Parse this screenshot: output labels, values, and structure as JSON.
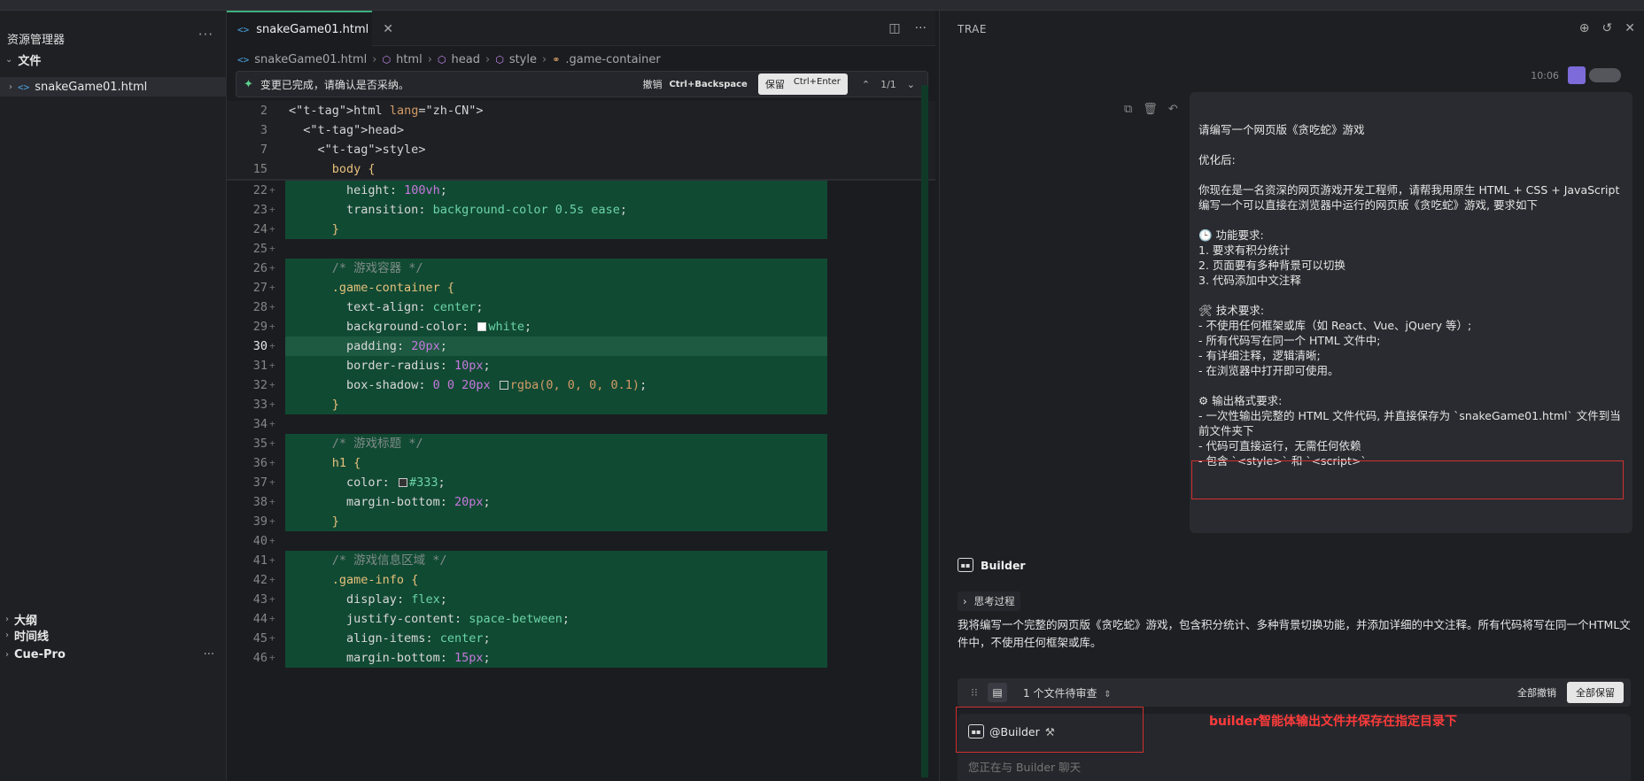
{
  "sidebar": {
    "title": "资源管理器",
    "more": "···",
    "section_files": "文件",
    "file": "snakeGame01.html",
    "section_outline": "大纲",
    "section_timeline": "时间线",
    "section_cue": "Cue-Pro"
  },
  "editor": {
    "tab_label": "snakeGame01.html",
    "breadcrumb": [
      "snakeGame01.html",
      "html",
      "head",
      "style",
      ".game-container"
    ],
    "review": {
      "message": "变更已完成，请确认是否采纳。",
      "undo": "撤销",
      "undo_key": "Ctrl+Backspace",
      "keep": "保留",
      "keep_key": "Ctrl+Enter",
      "counter": "1/1"
    },
    "sticky": [
      {
        "num": "2",
        "code": "<html lang=\"zh-CN\">"
      },
      {
        "num": "3",
        "code": "  <head>"
      },
      {
        "num": "7",
        "code": "    <style>"
      },
      {
        "num": "15",
        "code": "      body {"
      }
    ],
    "lines": [
      {
        "num": "22",
        "code": "        height: 100vh;"
      },
      {
        "num": "23",
        "code": "        transition: background-color 0.5s ease;"
      },
      {
        "num": "24",
        "code": "      }"
      },
      {
        "num": "25",
        "code": ""
      },
      {
        "num": "26",
        "code": "      /* 游戏容器 */"
      },
      {
        "num": "27",
        "code": "      .game-container {"
      },
      {
        "num": "28",
        "code": "        text-align: center;"
      },
      {
        "num": "29",
        "code": "        background-color: white;"
      },
      {
        "num": "30",
        "code": "        padding: 20px;"
      },
      {
        "num": "31",
        "code": "        border-radius: 10px;"
      },
      {
        "num": "32",
        "code": "        box-shadow: 0 0 20px rgba(0, 0, 0, 0.1);"
      },
      {
        "num": "33",
        "code": "      }"
      },
      {
        "num": "34",
        "code": ""
      },
      {
        "num": "35",
        "code": "      /* 游戏标题 */"
      },
      {
        "num": "36",
        "code": "      h1 {"
      },
      {
        "num": "37",
        "code": "        color: #333;"
      },
      {
        "num": "38",
        "code": "        margin-bottom: 20px;"
      },
      {
        "num": "39",
        "code": "      }"
      },
      {
        "num": "40",
        "code": ""
      },
      {
        "num": "41",
        "code": "      /* 游戏信息区域 */"
      },
      {
        "num": "42",
        "code": "      .game-info {"
      },
      {
        "num": "43",
        "code": "        display: flex;"
      },
      {
        "num": "44",
        "code": "        justify-content: space-between;"
      },
      {
        "num": "45",
        "code": "        align-items: center;"
      },
      {
        "num": "46",
        "code": "        margin-bottom: 15px;"
      }
    ],
    "active_line": "30"
  },
  "chat": {
    "title": "TRAE",
    "time": "10:06",
    "user_message": [
      "请编写一个网页版《贪吃蛇》游戏",
      "",
      "优化后:",
      "",
      "你现在是一名资深的网页游戏开发工程师，请帮我用原生 HTML + CSS + JavaScript",
      "编写一个可以直接在浏览器中运行的网页版《贪吃蛇》游戏, 要求如下",
      "",
      "🕒 功能要求:",
      "1. 要求有积分统计",
      "2. 页面要有多种背景可以切换",
      "3. 代码添加中文注释",
      "",
      "🛠 技术要求:",
      "- 不使用任何框架或库（如 React、Vue、jQuery 等）;",
      "- 所有代码写在同一个 HTML 文件中;",
      "- 有详细注释，逻辑清晰;",
      "- 在浏览器中打开即可使用。",
      "",
      "⚙ 输出格式要求:",
      "- 一次性输出完整的 HTML 文件代码, 并直接保存为 `snakeGame01.html` 文件到当",
      "前文件夹下",
      "- 代码可直接运行，无需任何依赖",
      "- 包含 `<style>` 和 `<script>`"
    ],
    "bot_name": "Builder",
    "thinking": "思考过程",
    "answer": "我将编写一个完整的网页版《贪吃蛇》游戏，包含积分统计、多种背景切换功能，并添加详细的中文注释。所有代码将写在同一个HTML文件中，不使用任何框架或库。",
    "review_count": "1 个文件待审查",
    "undo_all": "全部撤销",
    "keep_all": "全部保留",
    "mention": "@Builder",
    "placeholder": "您正在与 Builder 聊天",
    "annotation": "builder智能体输出文件并保存在指定目录下"
  },
  "colors": {
    "accent": "#3fae7a",
    "diff_added": "#114a33",
    "annotation_red": "#d03030"
  }
}
